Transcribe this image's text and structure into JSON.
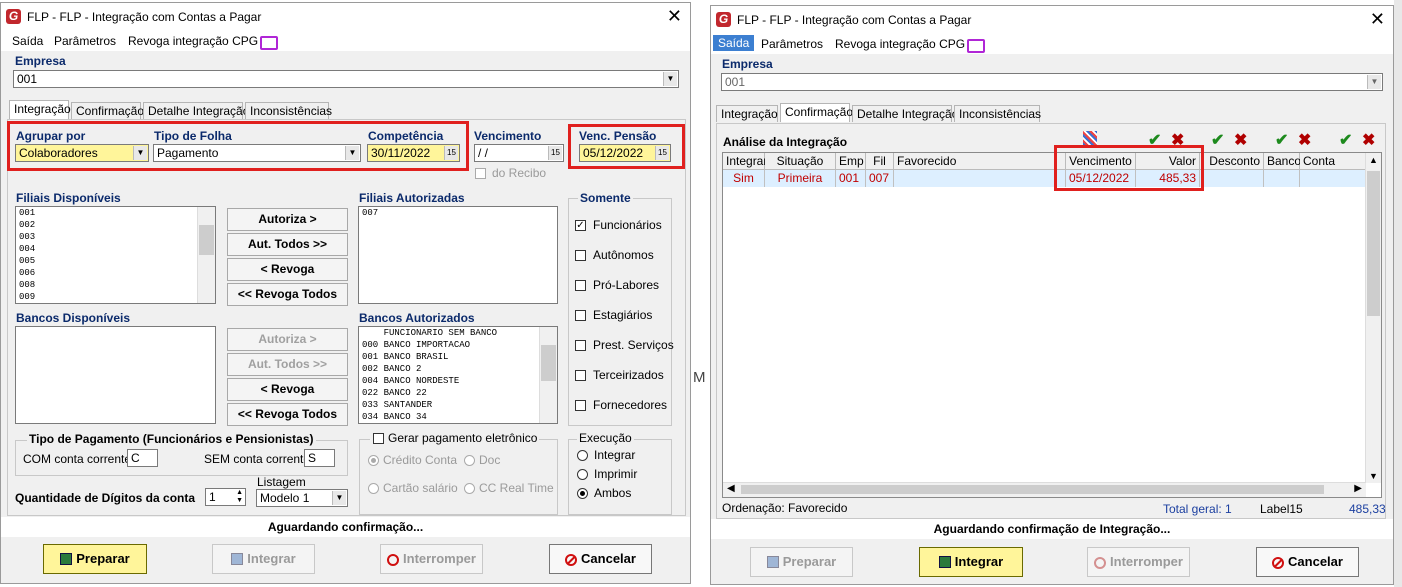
{
  "left": {
    "title": "FLP -  FLP - Integração com Contas a Pagar",
    "menu": [
      "Saída",
      "Parâmetros",
      "Revoga integração CPG"
    ],
    "empresa_label": "Empresa",
    "empresa_value": "001",
    "tabs": [
      "Integração",
      "Confirmação",
      "Detalhe Integração",
      "Inconsistências"
    ],
    "agrupar_label": "Agrupar por",
    "agrupar_value": "Colaboradores",
    "tipo_folha_label": "Tipo de Folha",
    "tipo_folha_value": "Pagamento",
    "competencia_label": "Competência",
    "competencia_value": "30/11/2022",
    "vencimento_label": "Vencimento",
    "vencimento_value": " /  /",
    "do_recibo_label": "do Recibo",
    "venc_pensao_label": "Venc. Pensão",
    "venc_pensao_value": "05/12/2022",
    "filiais_disp_label": "Filiais Disponíveis",
    "filiais_disp": [
      "001",
      "002",
      "003",
      "004",
      "005",
      "006",
      "008",
      "009"
    ],
    "filiais_aut_label": "Filiais Autorizadas",
    "filiais_aut": [
      "007"
    ],
    "bancos_disp_label": "Bancos Disponíveis",
    "bancos_aut_label": "Bancos Autorizados",
    "bancos_aut": [
      "    FUNCIONARIO SEM BANCO",
      "000 BANCO IMPORTACAO",
      "001 BANCO BRASIL",
      "002 BANCO 2",
      "004 BANCO NORDESTE",
      "022 BANCO 22",
      "033 SANTANDER",
      "034 BANCO 34"
    ],
    "btn_autoriza": "Autoriza >",
    "btn_aut_todos": "Aut. Todos >>",
    "btn_revoga": "< Revoga",
    "btn_revoga_todos": "<< Revoga Todos",
    "somente_label": "Somente",
    "somente": [
      {
        "label": "Funcionários",
        "checked": true
      },
      {
        "label": "Autônomos",
        "checked": false
      },
      {
        "label": "Pró-Labores",
        "checked": false
      },
      {
        "label": "Estagiários",
        "checked": false
      },
      {
        "label": "Prest. Serviços",
        "checked": false
      },
      {
        "label": "Terceirizados",
        "checked": false
      },
      {
        "label": "Fornecedores",
        "checked": false
      }
    ],
    "tipo_pag_label": "Tipo de Pagamento (Funcionários e Pensionistas)",
    "com_conta_label": "COM conta corrente",
    "com_conta_value": "C",
    "sem_conta_label": "SEM conta corrente",
    "sem_conta_value": "S",
    "gerar_label": "Gerar pagamento eletrônico",
    "credito_conta": "Crédito Conta",
    "doc": "Doc",
    "cartao_salario": "Cartão salário",
    "cc_real_time": "CC Real Time",
    "execucao_label": "Execução",
    "execucao": [
      "Integrar",
      "Imprimir",
      "Ambos"
    ],
    "qtd_digitos_label": "Quantidade de Dígitos da conta",
    "qtd_digitos_value": "1",
    "listagem_label": "Listagem",
    "listagem_value": "Modelo 1",
    "status": "Aguardando confirmação...",
    "btn_preparar": "Preparar",
    "btn_integrar": "Integrar",
    "btn_interromper": "Interromper",
    "btn_cancelar": "Cancelar"
  },
  "right": {
    "title": "FLP -  FLP - Integração com Contas a Pagar",
    "menu": [
      "Saída",
      "Parâmetros",
      "Revoga integração CPG"
    ],
    "empresa_label": "Empresa",
    "empresa_value": "001",
    "tabs": [
      "Integração",
      "Confirmação",
      "Detalhe Integração",
      "Inconsistências"
    ],
    "analise_label": "Análise da Integração",
    "columns": [
      "Integrar",
      "Situação",
      "Emp",
      "Fil",
      "Favorecido",
      "Vencimento",
      "Valor",
      "Desconto",
      "Banco",
      "Conta"
    ],
    "rows": [
      {
        "integrar": "Sim",
        "situacao": "Primeira",
        "emp": "001",
        "fil": "007",
        "favorecido": "",
        "vencimento": "05/12/2022",
        "valor": "485,33"
      }
    ],
    "ordenacao": "Ordenação: Favorecido",
    "total_geral": "Total geral: 1",
    "label15": "Label15",
    "total_valor": "485,33",
    "status": "Aguardando confirmação de Integração...",
    "btn_preparar": "Preparar",
    "btn_integrar": "Integrar",
    "btn_interromper": "Interromper",
    "btn_cancelar": "Cancelar"
  },
  "colors": {
    "highlight_red": "#e0201e",
    "yellow_field": "#fff59a",
    "menu_active": "#3c7fd1",
    "row_text": "#c00000"
  }
}
